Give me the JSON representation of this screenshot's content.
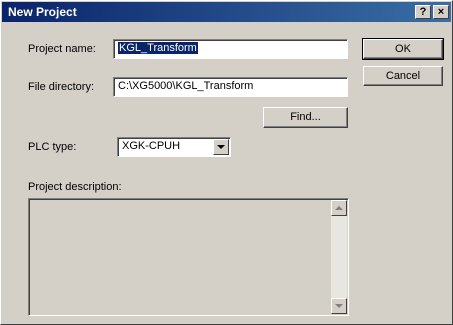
{
  "window": {
    "title": "New Project",
    "help_label": "?",
    "close_label": "×"
  },
  "form": {
    "project_name_label": "Project name:",
    "project_name_value": "KGL_Transform",
    "file_directory_label": "File directory:",
    "file_directory_value": "C:\\XG5000\\KGL_Transform",
    "plc_type_label": "PLC type:",
    "plc_type_value": "XGK-CPUH",
    "description_label": "Project description:",
    "description_value": ""
  },
  "buttons": {
    "ok": "OK",
    "cancel": "Cancel",
    "find": "Find..."
  },
  "colors": {
    "titlebar": "#0a246a",
    "face": "#d4d0c8",
    "selection": "#0a246a"
  }
}
